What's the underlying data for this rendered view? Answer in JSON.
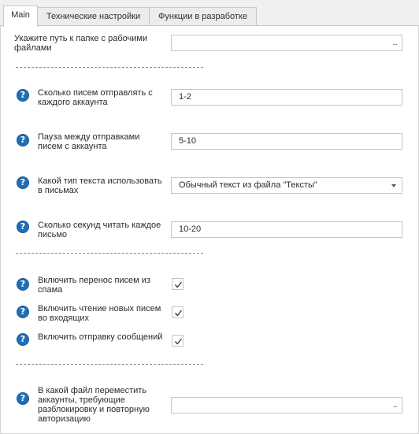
{
  "tabs": [
    {
      "label": "Main",
      "active": true
    },
    {
      "label": "Технические настройки",
      "active": false
    },
    {
      "label": "Функции в разработке",
      "active": false
    }
  ],
  "folder": {
    "label": "Укажите путь к папке с рабочими файлами",
    "value": "",
    "button": "..."
  },
  "emails_per_account": {
    "label": "Сколько писем отправлять с каждого аккаунта",
    "value": "1-2"
  },
  "pause": {
    "label": "Пауза между отправками писем с аккаунта",
    "value": "5-10"
  },
  "text_type": {
    "label": "Какой тип текста использовать в письмах",
    "value": "Обычный текст из файла \"Тексты\""
  },
  "read_seconds": {
    "label": "Сколько секунд читать каждое письмо",
    "value": "10-20"
  },
  "move_from_spam": {
    "label": "Включить перенос писем из спама",
    "checked": true
  },
  "read_new_inbox": {
    "label": "Включить чтение новых писем во входящих",
    "checked": true
  },
  "send_messages": {
    "label": "Включить отправку сообщений",
    "checked": true
  },
  "move_accounts": {
    "label": "В какой файл переместить аккаунты, требующие разблокировку и повторную авторизацию",
    "value": "",
    "button": "..."
  },
  "help_glyph": "?",
  "colors": {
    "help": "#1f6fb5",
    "tab_bg": "#f0f0f0",
    "border": "#c6c6c6"
  }
}
